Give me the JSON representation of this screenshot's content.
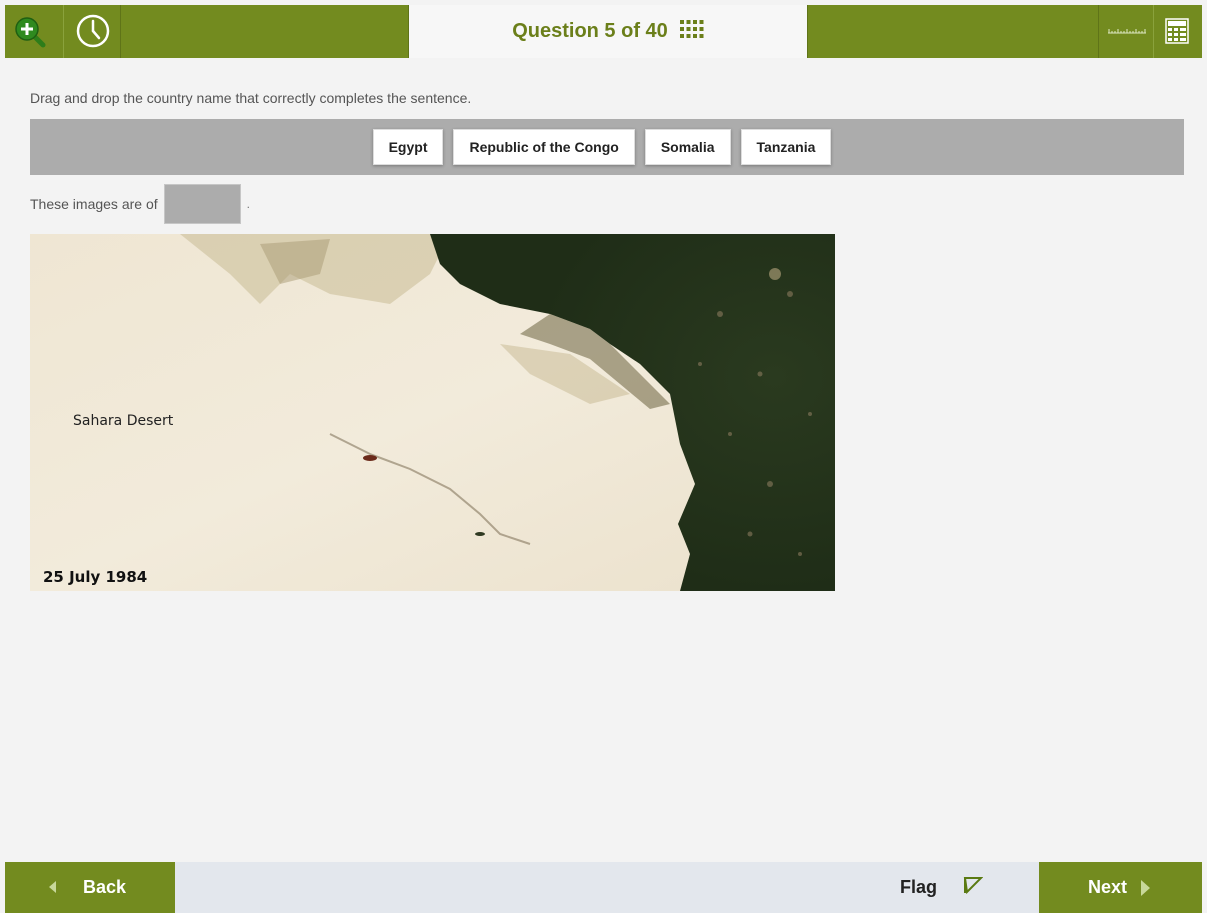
{
  "header": {
    "question_label": "Question 5 of 40",
    "zoom_icon": "zoom-in-icon",
    "timer_icon": "clock-icon",
    "navigator_icon": "grid-icon",
    "ruler_icon": "ruler-icon",
    "calculator_icon": "calculator-icon"
  },
  "instruction": "Drag and drop the country name that correctly completes the sentence.",
  "options": [
    "Egypt",
    "Republic of the Congo",
    "Somalia",
    "Tanzania"
  ],
  "sentence": {
    "prefix": "These images are of",
    "suffix": "."
  },
  "image": {
    "label": "Sahara Desert",
    "date": "25 July 1984"
  },
  "footer": {
    "back_label": "Back",
    "flag_label": "Flag",
    "next_label": "Next"
  },
  "colors": {
    "accent": "#738b1f",
    "tray": "#acacac",
    "footer_bg": "#e3e7ed"
  }
}
